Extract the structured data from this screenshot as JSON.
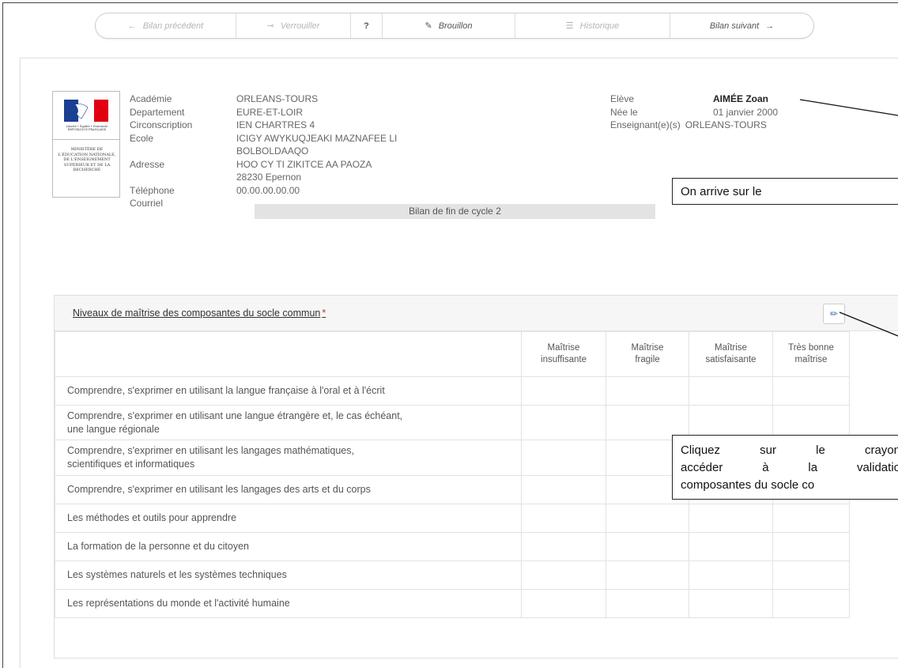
{
  "toolbar": {
    "prev": "Bilan précédent",
    "lock": "Verrouiller",
    "help": "?",
    "draft": "Brouillon",
    "history": "Historique",
    "next": "Bilan suivant"
  },
  "logo": {
    "motto": "Liberté • Égalité • Fraternité RÉPUBLIQUE FRANÇAISE",
    "ministry": "MINISTÈRE DE L'ÉDUCATION NATIONALE, DE L'ENSEIGNEMENT SUPÉRIEUR ET DE LA RECHERCHE"
  },
  "school": {
    "academie_label": "Académie",
    "academie": "ORLEANS-TOURS",
    "departement_label": "Departement",
    "departement": "EURE-ET-LOIR",
    "circ_label": "Circonscription",
    "circ": "IEN CHARTRES 4",
    "ecole_label": "Ecole",
    "ecole_1": "ICIGY AWYKUQJEAKI MAZNAFEE LI",
    "ecole_2": "BOLBOLDAAQO",
    "adresse_label": "Adresse",
    "adresse_1": "HOO CY TI ZIKITCE AA PAOZA",
    "adresse_2": "28230 Epernon",
    "tel_label": "Téléphone",
    "tel": "00.00.00.00.00",
    "courriel_label": "Courriel"
  },
  "student": {
    "eleve_label": "Elève",
    "eleve": "AIMÉE Zoan",
    "nee_label": "Née le",
    "nee": "01 janvier 2000",
    "ens_label": "Enseignant(e)(s)",
    "ens": "ORLEANS-TOURS"
  },
  "bilan_title": "Bilan de fin de cycle 2",
  "section": {
    "title": "Niveaux de maîtrise des composantes du socle commun",
    "required_mark": "*",
    "columns": [
      [
        "Maîtrise",
        "insuffisante"
      ],
      [
        "Maîtrise",
        "fragile"
      ],
      [
        "Maîtrise",
        "satisfaisante"
      ],
      [
        "Très bonne",
        "maîtrise"
      ]
    ],
    "rows": [
      "Comprendre, s'exprimer en utilisant la langue française à l'oral et à l'écrit",
      [
        "Comprendre, s'exprimer en utilisant une langue étrangère et, le cas échéant,",
        "une langue régionale"
      ],
      [
        "Comprendre, s'exprimer en utilisant les langages mathématiques,",
        "scientifiques et informatiques"
      ],
      "Comprendre, s'exprimer en utilisant les langages des arts et du corps",
      "Les méthodes et outils pour apprendre",
      "La formation de la personne et du citoyen",
      "Les systèmes naturels et les systèmes techniques",
      "Les représentations du monde et l'activité humaine"
    ]
  },
  "callouts": {
    "arrive": "On arrive sur le",
    "pencil_1": "Cliquez sur le crayon",
    "pencil_2": "accéder à la validatio",
    "pencil_3": "composantes du socle co"
  },
  "icons": {
    "prev": "arrow-left-icon",
    "lock": "key-icon",
    "draft": "edit-icon",
    "history": "list-icon",
    "next": "arrow-right-icon",
    "edit": "pencil-icon"
  }
}
